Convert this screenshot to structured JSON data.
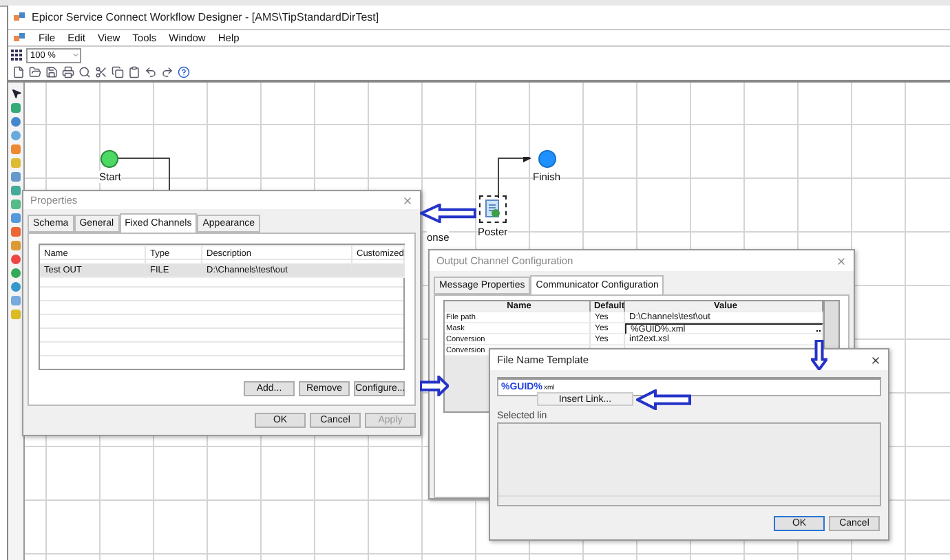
{
  "window": {
    "title": "Epicor Service Connect Workflow Designer - [AMS\\TipStandardDirTest]"
  },
  "menu": [
    "File",
    "Edit",
    "View",
    "Tools",
    "Window",
    "Help"
  ],
  "zoom": {
    "value": "100 %"
  },
  "canvas": {
    "nodes": [
      {
        "kind": "start",
        "label": "Start",
        "selected": false
      },
      {
        "kind": "finish",
        "label": "Finish",
        "selected": false
      },
      {
        "kind": "label",
        "label": "onse",
        "selected": false
      },
      {
        "kind": "poster",
        "label": "Poster",
        "selected": true
      }
    ]
  },
  "properties_dialog": {
    "title": "Properties",
    "tabs": [
      {
        "label": "Schema",
        "selected": false
      },
      {
        "label": "General",
        "selected": false
      },
      {
        "label": "Fixed Channels",
        "selected": true
      },
      {
        "label": "Appearance",
        "selected": false
      }
    ],
    "columns": [
      "Name",
      "Type",
      "Description",
      "Customized"
    ],
    "rows": [
      {
        "cells": [
          "Test OUT",
          "FILE",
          "D:\\Channels\\test\\out",
          ""
        ],
        "selected": true
      }
    ],
    "actions": [
      {
        "label": "Add...",
        "disabled": false
      },
      {
        "label": "Remove",
        "disabled": false
      },
      {
        "label": "Configure...",
        "disabled": false
      }
    ],
    "buttons": [
      {
        "label": "OK",
        "disabled": false
      },
      {
        "label": "Cancel",
        "disabled": false
      },
      {
        "label": "Apply",
        "disabled": true
      }
    ]
  },
  "output_channel_dialog": {
    "title": "Output Channel Configuration",
    "tabs": [
      {
        "label": "Message Properties",
        "selected": false
      },
      {
        "label": "Communicator Configuration",
        "selected": true
      }
    ],
    "columns": [
      "Name",
      "Default",
      "Value"
    ],
    "rows": [
      {
        "cells": [
          "File path",
          "Yes",
          "D:\\Channels\\test\\out"
        ],
        "editing": false
      },
      {
        "cells": [
          "Mask",
          "Yes",
          "%GUID%.xml"
        ],
        "editing": true
      },
      {
        "cells": [
          "Conversion",
          "Yes",
          "int2ext.xsl"
        ],
        "editing": false
      },
      {
        "cells": [
          "Conversion",
          "",
          ""
        ],
        "editing": false
      }
    ]
  },
  "file_name_template_dialog": {
    "title": "File Name Template",
    "template": {
      "link": "%GUID%",
      "text": "xml"
    },
    "context_menu": [
      "Insert Link..."
    ],
    "selected_link_label": "Selected lin",
    "buttons": [
      {
        "label": "OK",
        "default": true
      },
      {
        "label": "Cancel",
        "default": false
      }
    ]
  }
}
